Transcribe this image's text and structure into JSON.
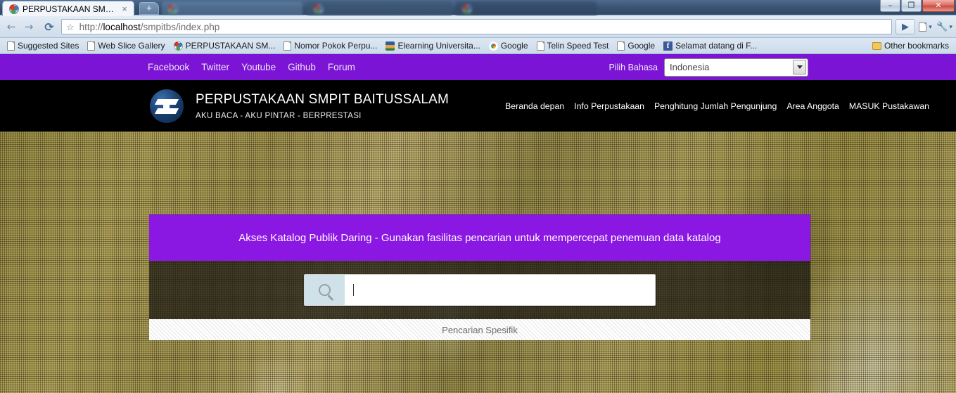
{
  "browser": {
    "active_tab": {
      "title": "PERPUSTAKAAN SMPIT ...",
      "close": "×",
      "favicon": "site-favicon"
    },
    "background_tabs": [
      {
        "title": ""
      },
      {
        "title": ""
      },
      {
        "title": ""
      }
    ],
    "new_tab_label": "+",
    "window_controls": {
      "minimize": "–",
      "restore": "❐",
      "close": "✕"
    },
    "nav": {
      "back": "←",
      "forward": "→",
      "reload": "⟳"
    },
    "url": {
      "prefix": "http://",
      "host": "localhost",
      "path": "/smpitbs/index.php",
      "star": "☆"
    },
    "toolbar": {
      "go": "▶",
      "page_menu": "▾",
      "wrench_menu": "▾"
    },
    "bookmarks": [
      {
        "label": "Suggested Sites",
        "icon": "page-icon"
      },
      {
        "label": "Web Slice Gallery",
        "icon": "page-icon"
      },
      {
        "label": "PERPUSTAKAAN SM...",
        "icon": "site-logo-icon"
      },
      {
        "label": "Nomor Pokok Perpu...",
        "icon": "page-icon"
      },
      {
        "label": "Elearning Universita...",
        "icon": "elearning-icon"
      },
      {
        "label": "Google",
        "icon": "google-icon"
      },
      {
        "label": "Telin Speed Test",
        "icon": "page-icon"
      },
      {
        "label": "Google",
        "icon": "page-icon"
      },
      {
        "label": "Selamat datang di F...",
        "icon": "facebook-icon"
      }
    ],
    "other_bookmarks": {
      "label": "Other bookmarks",
      "icon": "folder-icon"
    }
  },
  "site": {
    "topbar": {
      "social_links": [
        "Facebook",
        "Twitter",
        "Youtube",
        "Github",
        "Forum"
      ],
      "language_label": "Pilih Bahasa",
      "language_value": "Indonesia"
    },
    "header": {
      "title": "PERPUSTAKAAN SMPIT BAITUSSALAM",
      "tagline": "AKU BACA - AKU PINTAR - BERPRESTASI",
      "nav": [
        "Beranda depan",
        "Info Perpustakaan",
        "Penghitung Jumlah Pengunjung",
        "Area Anggota",
        "MASUK Pustakawan"
      ]
    },
    "opac": {
      "banner": "Akses Katalog Publik Daring - Gunakan fasilitas pencarian untuk mempercepat penemuan data katalog",
      "search_value": "",
      "search_placeholder": "",
      "search_icon": "magnifier-icon",
      "specific_search": "Pencarian Spesifik"
    }
  },
  "colors": {
    "purple_bar": "#7b14d4",
    "purple_banner": "#8b17e3",
    "header_black": "#000000",
    "search_icon_bg": "#cfe2ea"
  }
}
